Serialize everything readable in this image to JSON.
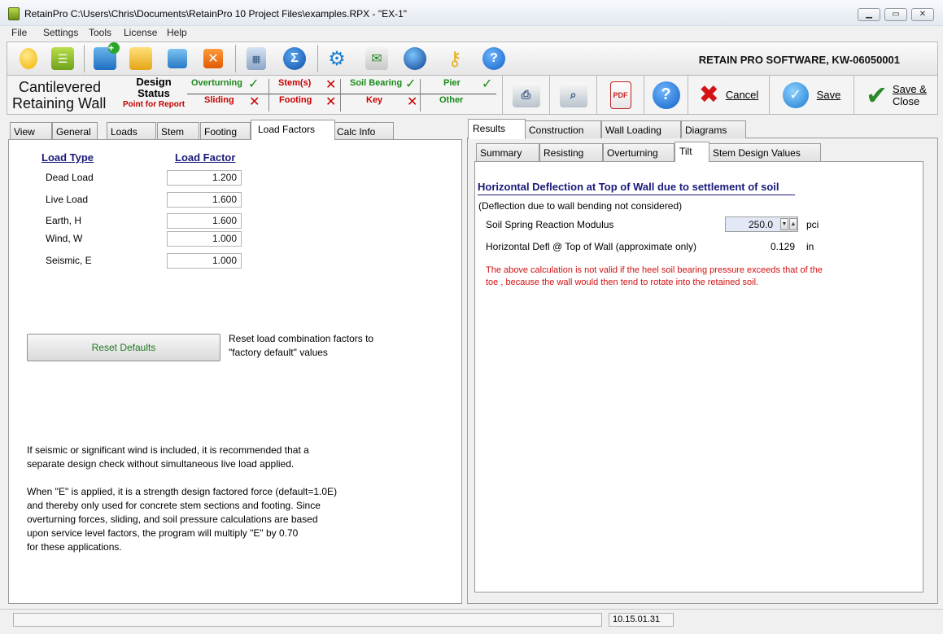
{
  "window": {
    "title": "RetainPro C:\\Users\\Chris\\Documents\\RetainPro 10 Project Files\\examples.RPX - \"EX-1\""
  },
  "menu": [
    "File",
    "Settings",
    "Tools",
    "License",
    "Help"
  ],
  "toolbar": {
    "company": "RETAIN PRO SOFTWARE, KW-06050001"
  },
  "status": {
    "wall_title_1": "Cantilevered",
    "wall_title_2": "Retaining Wall",
    "design_1": "Design",
    "design_2": "Status",
    "point_for_report": "Point for Report",
    "items": {
      "overturning": "Overturning",
      "sliding": "Sliding",
      "stems": "Stem(s)",
      "footing": "Footing",
      "soil_bearing": "Soil Bearing",
      "key": "Key",
      "pier": "Pier",
      "other": "Other"
    },
    "cancel_label": "Cancel",
    "save_label": "Save",
    "save_close_1": "Save &",
    "save_close_2": "Close"
  },
  "left_tabs": [
    "View",
    "General",
    "Loads",
    "Stem",
    "Footing",
    "Load Factors",
    "Calc Info"
  ],
  "left": {
    "col_load_type": "Load Type",
    "col_load_factor": "Load Factor",
    "rows": [
      {
        "label": "Dead Load",
        "value": "1.200"
      },
      {
        "label": "Live Load",
        "value": "1.600"
      },
      {
        "label": "Earth,  H",
        "value": "1.600"
      },
      {
        "label": "Wind,  W",
        "value": "1.000"
      },
      {
        "label": "Seismic,  E",
        "value": "1.000"
      }
    ],
    "reset_label": "Reset Defaults",
    "reset_desc_1": "Reset load combination factors to",
    "reset_desc_2": "\"factory default\" values",
    "note1_1": "If seismic or significant wind is included, it is recommended that a",
    "note1_2": "separate design check without simultaneous live load applied.",
    "note2_1": "When \"E\" is applied, it is a strength design factored force (default=1.0E)",
    "note2_2": "and thereby only used for concrete stem sections and footing.  Since",
    "note2_3": "overturning forces, sliding, and soil pressure calculations are based",
    "note2_4": "upon service level factors, the program will multiply \"E\" by 0.70",
    "note2_5": "for these applications."
  },
  "right_tabs": [
    "Results",
    "Construction",
    "Wall Loading",
    "Diagrams"
  ],
  "right_subtabs": [
    "Summary",
    "Resisting",
    "Overturning",
    "Tilt",
    "Stem Design Values"
  ],
  "right": {
    "heading": "Horizontal Deflection at Top of Wall due to settlement of soil",
    "subnote": "(Deflection due to wall bending not considered)",
    "modulus_label": "Soil Spring Reaction Modulus",
    "modulus_value": "250.0",
    "modulus_unit": "pci",
    "defl_label": "Horizontal Defl @ Top of Wall (approximate only)",
    "defl_value": "0.129",
    "defl_unit": "in",
    "warning_1": "The above calculation is not valid if the heel soil bearing pressure exceeds that of the",
    "warning_2": "toe , because the wall would then tend to rotate into the retained soil."
  },
  "statusbar": {
    "version": "10.15.01.31"
  },
  "colors": {
    "ok_green": "#198a19",
    "fail_red": "#c80000",
    "heading_navy": "#1a1a7a",
    "warning_red": "#d01010"
  }
}
